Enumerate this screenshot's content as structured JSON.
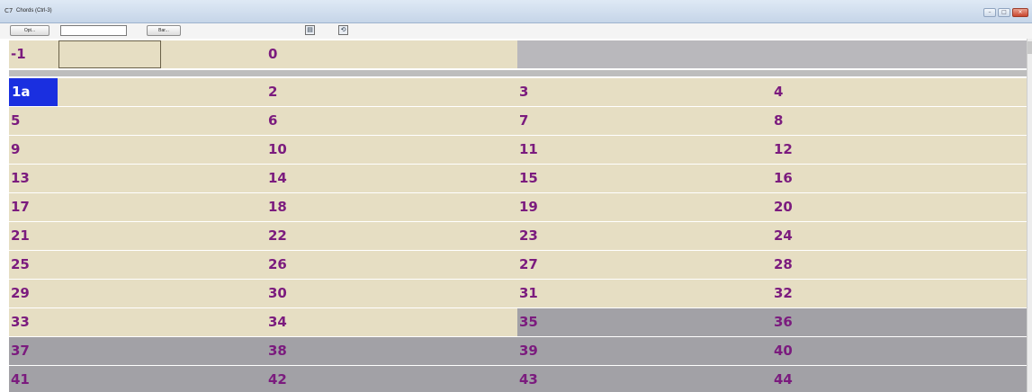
{
  "window": {
    "title": "Chords (Ctrl-3)",
    "title_icon": "C7",
    "controls": [
      "minimize-icon",
      "maximize-icon",
      "close-icon"
    ],
    "control_glyphs": {
      "minimize": "–",
      "maximize": "□",
      "close": "×"
    }
  },
  "toolbar": {
    "opt_label": "Opt...",
    "field_value": "",
    "bar_label": "Bar...",
    "icon1": "▤",
    "icon2": "⟲"
  },
  "chords": {
    "top_row": [
      {
        "bar": "-1",
        "chord": ""
      },
      {
        "bar": "0",
        "chord": ""
      }
    ],
    "rows": [
      [
        "1a",
        "2",
        "3",
        "4"
      ],
      [
        "5",
        "6",
        "7",
        "8"
      ],
      [
        "9",
        "10",
        "11",
        "12"
      ],
      [
        "13",
        "14",
        "15",
        "16"
      ],
      [
        "17",
        "18",
        "19",
        "20"
      ],
      [
        "21",
        "22",
        "23",
        "24"
      ],
      [
        "25",
        "26",
        "27",
        "28"
      ],
      [
        "29",
        "30",
        "31",
        "32"
      ],
      [
        "33",
        "34",
        "35",
        "36"
      ],
      [
        "37",
        "38",
        "39",
        "40"
      ],
      [
        "41",
        "42",
        "43",
        "44"
      ]
    ],
    "selected_bar": "1a",
    "grayed_from_bar": "35"
  },
  "colors": {
    "bar_bg": "#e6dec3",
    "empty_bg": "#a2a1a6",
    "text": "#7b1b7e",
    "selection": "#1a2fe0"
  }
}
